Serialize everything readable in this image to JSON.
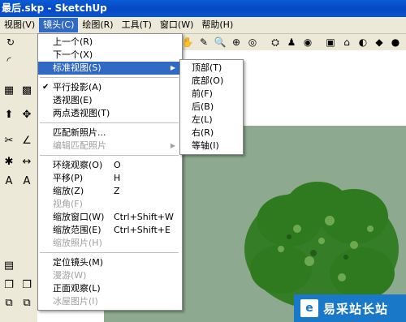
{
  "window": {
    "title": "最后.skp - SketchUp"
  },
  "menubar": {
    "items": [
      {
        "label": "视图(V)"
      },
      {
        "label": "镜头(C)"
      },
      {
        "label": "绘图(R)"
      },
      {
        "label": "工具(T)"
      },
      {
        "label": "窗口(W)"
      },
      {
        "label": "帮助(H)"
      }
    ]
  },
  "camera_menu": {
    "items": [
      {
        "label": "上一个(R)"
      },
      {
        "label": "下一个(X)"
      },
      {
        "label": "标准视图(S)"
      },
      {
        "label": "平行投影(A)"
      },
      {
        "label": "透视图(E)"
      },
      {
        "label": "两点透视图(T)"
      },
      {
        "label": "匹配新照片..."
      },
      {
        "label": "编辑匹配照片"
      },
      {
        "label": "环绕观察(O)",
        "shortcut": "O"
      },
      {
        "label": "平移(P)",
        "shortcut": "H"
      },
      {
        "label": "缩放(Z)",
        "shortcut": "Z"
      },
      {
        "label": "视角(F)"
      },
      {
        "label": "缩放窗口(W)",
        "shortcut": "Ctrl+Shift+W"
      },
      {
        "label": "缩放范围(E)",
        "shortcut": "Ctrl+Shift+E"
      },
      {
        "label": "缩放照片(H)"
      },
      {
        "label": "定位镜头(M)"
      },
      {
        "label": "漫游(W)"
      },
      {
        "label": "正面观察(L)"
      },
      {
        "label": "冰屋图片(I)"
      }
    ]
  },
  "standard_views_submenu": {
    "items": [
      {
        "label": "顶部(T)"
      },
      {
        "label": "底部(O)"
      },
      {
        "label": "前(F)"
      },
      {
        "label": "后(B)"
      },
      {
        "label": "左(L)"
      },
      {
        "label": "右(R)"
      },
      {
        "label": "等轴(I)"
      }
    ]
  },
  "watermark": {
    "logo": "e",
    "text": "易采站长站"
  },
  "colors": {
    "highlight": "#316ac5",
    "ground": "#8daa90",
    "tree": "#2f7a1f"
  }
}
